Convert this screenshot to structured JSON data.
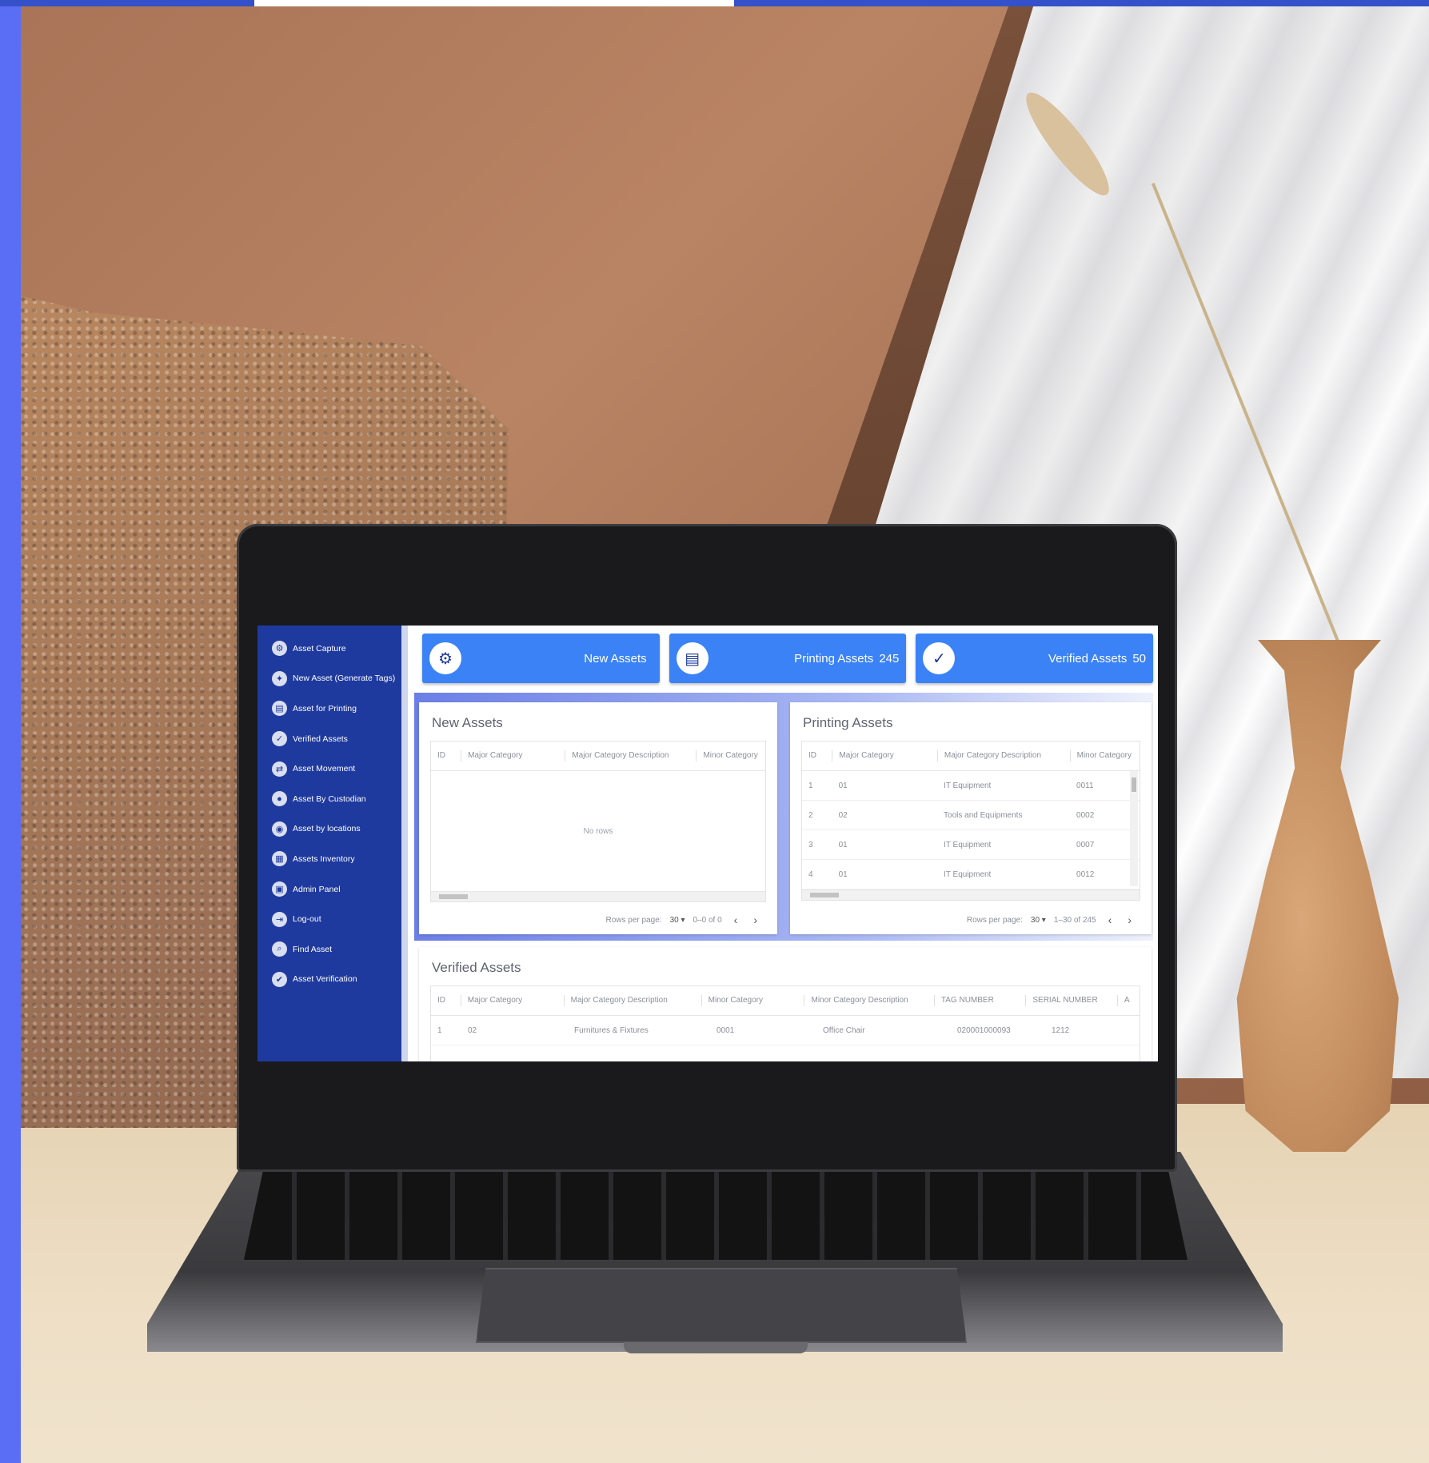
{
  "sidebar": {
    "items": [
      {
        "label": "Asset Capture",
        "icon": "gear-icon"
      },
      {
        "label": "New Asset (Generate Tags)",
        "icon": "tag-icon"
      },
      {
        "label": "Asset for Printing",
        "icon": "printer-icon"
      },
      {
        "label": "Verified Assets",
        "icon": "check-document-icon"
      },
      {
        "label": "Asset Movement",
        "icon": "movement-icon"
      },
      {
        "label": "Asset By Custodian",
        "icon": "user-icon"
      },
      {
        "label": "Asset by locations",
        "icon": "location-icon"
      },
      {
        "label": "Assets Inventory",
        "icon": "inventory-icon"
      },
      {
        "label": "Admin Panel",
        "icon": "admin-icon"
      },
      {
        "label": "Log-out",
        "icon": "logout-icon"
      },
      {
        "label": "Find Asset",
        "icon": "search-icon"
      },
      {
        "label": "Asset Verification",
        "icon": "verify-icon"
      }
    ]
  },
  "cards": [
    {
      "label": "New Assets",
      "count": "",
      "icon": "gear-icon"
    },
    {
      "label": "Printing Assets",
      "count": "245",
      "icon": "printer-icon"
    },
    {
      "label": "Verified Assets",
      "count": "50",
      "icon": "check-document-icon"
    }
  ],
  "new_assets": {
    "title": "New Assets",
    "columns": [
      "ID",
      "Major Category",
      "Major Category Description",
      "Minor Category"
    ],
    "empty_text": "No rows",
    "rows_per_page_label": "Rows per page:",
    "rows_per_page": "30",
    "range": "0–0 of 0"
  },
  "printing_assets": {
    "title": "Printing Assets",
    "columns": [
      "ID",
      "Major Category",
      "Major Category Description",
      "Minor Category"
    ],
    "rows": [
      [
        "1",
        "01",
        "IT Equipment",
        "0011"
      ],
      [
        "2",
        "02",
        "Tools and Equipments",
        "0002"
      ],
      [
        "3",
        "01",
        "IT Equipment",
        "0007"
      ],
      [
        "4",
        "01",
        "IT Equipment",
        "0012"
      ]
    ],
    "rows_per_page_label": "Rows per page:",
    "rows_per_page": "30",
    "range": "1–30 of 245"
  },
  "verified_assets": {
    "title": "Verified Assets",
    "columns": [
      "ID",
      "Major Category",
      "Major Category Description",
      "Minor Category",
      "Minor Category Description",
      "TAG NUMBER",
      "SERIAL NUMBER",
      "A"
    ],
    "rows": [
      [
        "1",
        "02",
        "Furnitures & Fixtures",
        "0001",
        "Office Chair",
        "020001000093",
        "1212",
        ""
      ]
    ]
  },
  "colors": {
    "sidebar": "#1f3a9e",
    "card": "#3b82f6",
    "accent_stripe": "#5a6ef5"
  }
}
